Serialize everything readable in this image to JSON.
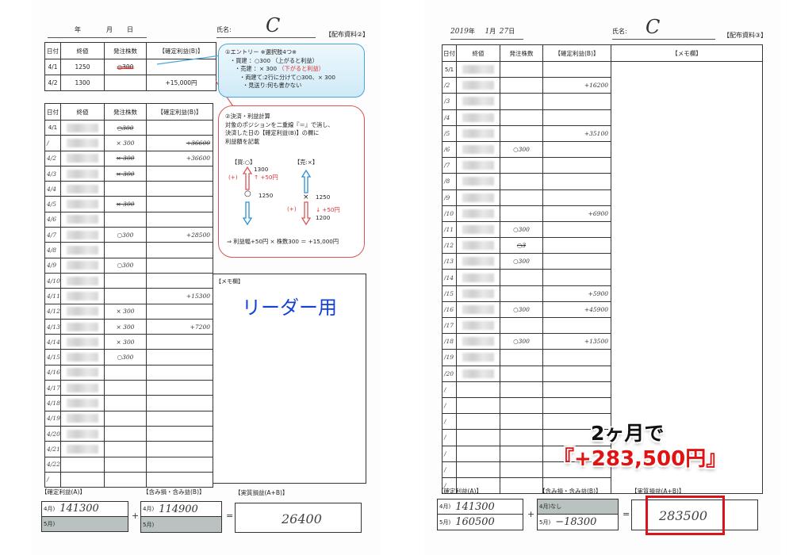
{
  "left_sheet": {
    "date_header": {
      "year_label": "年",
      "month_label": "月",
      "day_label": "日"
    },
    "name_label": "氏名:",
    "name_value": "C",
    "doc_label": "【配布資料②】",
    "example_table": {
      "headers": [
        "日付",
        "終値",
        "発注株数",
        "【確定利益(B)】"
      ],
      "rows": [
        {
          "date": "4/1",
          "close": "1250",
          "qty": "○300",
          "profit": ""
        },
        {
          "date": "4/2",
          "close": "1300",
          "qty": "",
          "profit": "+15,000円"
        }
      ]
    },
    "callout_entry": {
      "title": "①エントリー ※選択肢4つ※",
      "lines": [
        {
          "text": "・買建 ：○300 （上がると利益）",
          "accent": ""
        },
        {
          "text": "・売建 ：× 300 ",
          "accent": "（下がると利益）"
        },
        {
          "text": "・両建て:2行に分けて○300、× 300",
          "accent": ""
        },
        {
          "text": "・見送り:何も書かない",
          "accent": ""
        }
      ]
    },
    "callout_settle": {
      "title": "②決済・利益計算",
      "lines": [
        "対象のポジションを二重線『＝』で消し、",
        "決済した日の【確定利益(B)】の欄に",
        "利益額を記載"
      ],
      "buy_label": "【買:○】",
      "sell_label": "【売:×】",
      "buy_high": "1300",
      "buy_low": "1250",
      "buy_gain": "↑ +50円",
      "sell_high": "1250",
      "sell_low": "1200",
      "sell_gain": "↓ +50円",
      "plus_label": "(+)",
      "formula": "⇒ 利益幅+50円 × 株数300 ＝ +15,000円"
    },
    "main_table": {
      "headers": [
        "日付",
        "終値",
        "発注株数",
        "【確定利益(B)】"
      ],
      "rows": [
        {
          "date": "4/1",
          "qty": "○300",
          "qty_struck": true,
          "profit": "",
          "profit_struck": false
        },
        {
          "date": "/",
          "qty": "× 300",
          "qty_struck": false,
          "profit": "+36600",
          "profit_struck": true
        },
        {
          "date": "4/2",
          "qty": "× 300",
          "qty_struck": true,
          "profit": "+36600",
          "profit_struck": false
        },
        {
          "date": "4/3",
          "qty": "× 300",
          "qty_struck": true,
          "profit": "",
          "profit_struck": false
        },
        {
          "date": "4/4",
          "qty": "",
          "qty_struck": false,
          "profit": "",
          "profit_struck": false
        },
        {
          "date": "4/5",
          "qty": "× 300",
          "qty_struck": true,
          "profit": "",
          "profit_struck": false
        },
        {
          "date": "4/6",
          "qty": "",
          "qty_struck": false,
          "profit": "",
          "profit_struck": false
        },
        {
          "date": "4/7",
          "qty": "○300",
          "qty_struck": false,
          "profit": "+28500",
          "profit_struck": false
        },
        {
          "date": "4/8",
          "qty": "",
          "qty_struck": false,
          "profit": "",
          "profit_struck": false
        },
        {
          "date": "4/9",
          "qty": "○300",
          "qty_struck": false,
          "profit": "",
          "profit_struck": false
        },
        {
          "date": "4/10",
          "qty": "",
          "qty_struck": false,
          "profit": "",
          "profit_struck": false
        },
        {
          "date": "4/11",
          "qty": "",
          "qty_struck": false,
          "profit": "+15300",
          "profit_struck": false
        },
        {
          "date": "4/12",
          "qty": "× 300",
          "qty_struck": false,
          "profit": "",
          "profit_struck": false
        },
        {
          "date": "4/13",
          "qty": "× 300",
          "qty_struck": false,
          "profit": "+7200",
          "profit_struck": false
        },
        {
          "date": "4/14",
          "qty": "× 300",
          "qty_struck": false,
          "profit": "",
          "profit_struck": false
        },
        {
          "date": "4/15",
          "qty": "○300",
          "qty_struck": false,
          "profit": "",
          "profit_struck": false
        },
        {
          "date": "4/16",
          "qty": "",
          "qty_struck": false,
          "profit": "",
          "profit_struck": false
        },
        {
          "date": "4/17",
          "qty": "",
          "qty_struck": false,
          "profit": "",
          "profit_struck": false
        },
        {
          "date": "4/18",
          "qty": "",
          "qty_struck": false,
          "profit": "",
          "profit_struck": false
        },
        {
          "date": "4/19",
          "qty": "",
          "qty_struck": false,
          "profit": "",
          "profit_struck": false
        },
        {
          "date": "4/20",
          "qty": "",
          "qty_struck": false,
          "profit": "",
          "profit_struck": false
        },
        {
          "date": "4/21",
          "qty": "",
          "qty_struck": false,
          "profit": "",
          "profit_struck": false
        },
        {
          "date": "4/22",
          "qty": "",
          "qty_struck": false,
          "profit": "",
          "profit_struck": false
        },
        {
          "date": "/",
          "qty": "",
          "qty_struck": false,
          "profit": "",
          "profit_struck": false
        }
      ]
    },
    "memo": {
      "label": "【メモ欄】",
      "text": "リーダー用"
    },
    "summary": {
      "confirmed_label": "【確定利益(A)】",
      "unrealized_label": "【含み損・含み益(B)】",
      "actual_label": "【実質損益(A+B)】",
      "confirmed": [
        {
          "month": "4月)",
          "value": "141300"
        },
        {
          "month": "5月)",
          "value": ""
        }
      ],
      "unrealized": [
        {
          "month": "4月)",
          "value": "114900"
        },
        {
          "month": "5月)",
          "value": ""
        }
      ],
      "plus": "+",
      "equals": "=",
      "actual": "26400"
    }
  },
  "right_sheet": {
    "date_header": {
      "year": "2019",
      "year_label": "年",
      "month": "1",
      "month_label": "月",
      "day": "27",
      "day_label": "日"
    },
    "name_label": "氏名:",
    "name_value": "C",
    "doc_label": "【配布資料③】",
    "table": {
      "headers": [
        "日付",
        "終値",
        "発注株数",
        "【確定利益(B)】",
        "【メモ欄】"
      ],
      "rows": [
        {
          "date": "5/1",
          "qty": "",
          "qty_struck": false,
          "profit": ""
        },
        {
          "date": "/2",
          "qty": "",
          "qty_struck": false,
          "profit": "+16200"
        },
        {
          "date": "/3",
          "qty": "",
          "qty_struck": false,
          "profit": ""
        },
        {
          "date": "/4",
          "qty": "",
          "qty_struck": false,
          "profit": ""
        },
        {
          "date": "/5",
          "qty": "",
          "qty_struck": false,
          "profit": "+35100"
        },
        {
          "date": "/6",
          "qty": "○300",
          "qty_struck": false,
          "profit": ""
        },
        {
          "date": "/7",
          "qty": "",
          "qty_struck": false,
          "profit": ""
        },
        {
          "date": "/8",
          "qty": "",
          "qty_struck": false,
          "profit": ""
        },
        {
          "date": "/9",
          "qty": "",
          "qty_struck": false,
          "profit": ""
        },
        {
          "date": "/10",
          "qty": "",
          "qty_struck": false,
          "profit": "+6900"
        },
        {
          "date": "/11",
          "qty": "○300",
          "qty_struck": false,
          "profit": ""
        },
        {
          "date": "/12",
          "qty": "○3",
          "qty_struck": true,
          "profit": ""
        },
        {
          "date": "/13",
          "qty": "○300",
          "qty_struck": false,
          "profit": ""
        },
        {
          "date": "/14",
          "qty": "",
          "qty_struck": false,
          "profit": ""
        },
        {
          "date": "/15",
          "qty": "",
          "qty_struck": false,
          "profit": "+5900"
        },
        {
          "date": "/16",
          "qty": "○300",
          "qty_struck": false,
          "profit": "+45900"
        },
        {
          "date": "/17",
          "qty": "",
          "qty_struck": false,
          "profit": ""
        },
        {
          "date": "/18",
          "qty": "○300",
          "qty_struck": false,
          "profit": "+13500"
        },
        {
          "date": "/19",
          "qty": "",
          "qty_struck": false,
          "profit": ""
        },
        {
          "date": "/20",
          "qty": "",
          "qty_struck": false,
          "profit": ""
        },
        {
          "date": "/",
          "qty": "",
          "qty_struck": false,
          "profit": ""
        },
        {
          "date": "/",
          "qty": "",
          "qty_struck": false,
          "profit": ""
        },
        {
          "date": "/",
          "qty": "",
          "qty_struck": false,
          "profit": ""
        },
        {
          "date": "/",
          "qty": "",
          "qty_struck": false,
          "profit": ""
        },
        {
          "date": "/",
          "qty": "",
          "qty_struck": false,
          "profit": ""
        },
        {
          "date": "/",
          "qty": "",
          "qty_struck": false,
          "profit": ""
        },
        {
          "date": "/",
          "qty": "",
          "qty_struck": false,
          "profit": ""
        }
      ]
    },
    "summary": {
      "confirmed_label": "【確定利益(A)】",
      "unrealized_label": "【含み損・含み益(B)】",
      "actual_label": "【実質損益(A+B)】",
      "confirmed": [
        {
          "month": "4月)",
          "value": "141300"
        },
        {
          "month": "5月)",
          "value": "160500"
        }
      ],
      "unrealized": [
        {
          "month": "4月)なし",
          "value": ""
        },
        {
          "month": "5月)",
          "value": "−18300"
        }
      ],
      "plus": "+",
      "equals": "=",
      "actual": "283500"
    }
  },
  "promo": {
    "line1": "2ヶ月で",
    "line2": "『+283,500円』",
    "accent_color": "#e01212",
    "highlight_color": "#d9141a"
  }
}
